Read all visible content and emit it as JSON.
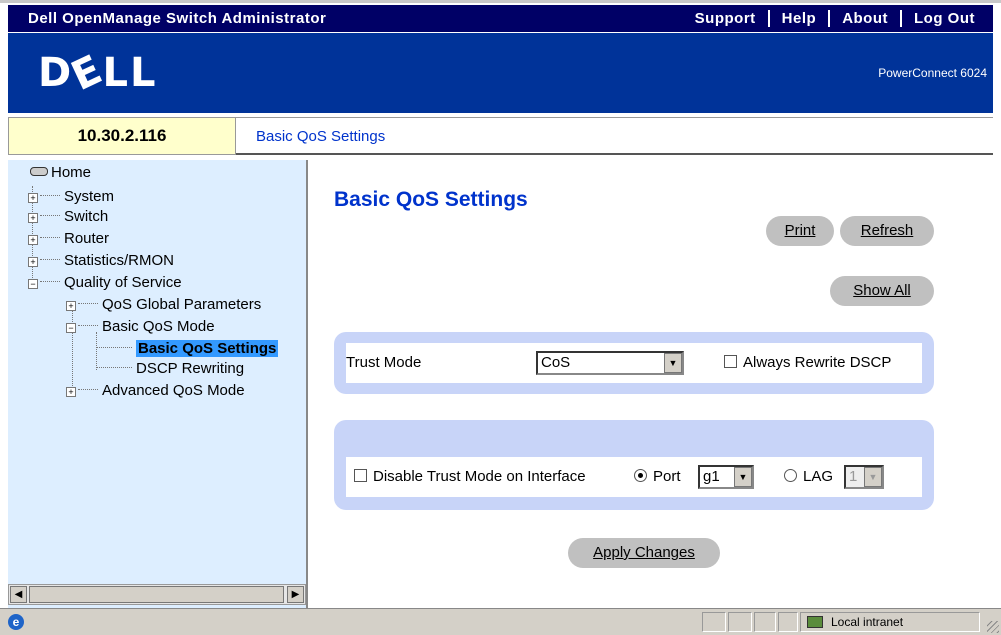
{
  "app": {
    "title": "Dell OpenManage Switch Administrator",
    "nav": [
      "Support",
      "Help",
      "About",
      "Log Out"
    ]
  },
  "banner": {
    "logo": "DELL",
    "model": "PowerConnect 6024"
  },
  "address": {
    "ip": "10.30.2.116",
    "breadcrumb": "Basic QoS Settings"
  },
  "tree": {
    "home": "Home",
    "items": {
      "system": "System",
      "switch": "Switch",
      "router": "Router",
      "statistics": "Statistics/RMON",
      "qos": "Quality of Service",
      "qos_global": "QoS Global Parameters",
      "basic_mode": "Basic QoS Mode",
      "basic_settings": "Basic QoS Settings",
      "dscp_rewriting": "DSCP Rewriting",
      "advanced_mode": "Advanced QoS Mode"
    }
  },
  "main": {
    "title": "Basic QoS Settings",
    "print_label": "Print",
    "refresh_label": "Refresh",
    "show_all_label": "Show All",
    "trust_mode_label": "Trust Mode",
    "trust_mode_value": "CoS",
    "always_rewrite_label": "Always Rewrite DSCP",
    "disable_trust_label": "Disable Trust Mode on Interface",
    "port_label": "Port",
    "port_value": "g1",
    "lag_label": "LAG",
    "lag_value": "1",
    "apply_label": "Apply Changes"
  },
  "statusbar": {
    "zone": "Local intranet"
  }
}
